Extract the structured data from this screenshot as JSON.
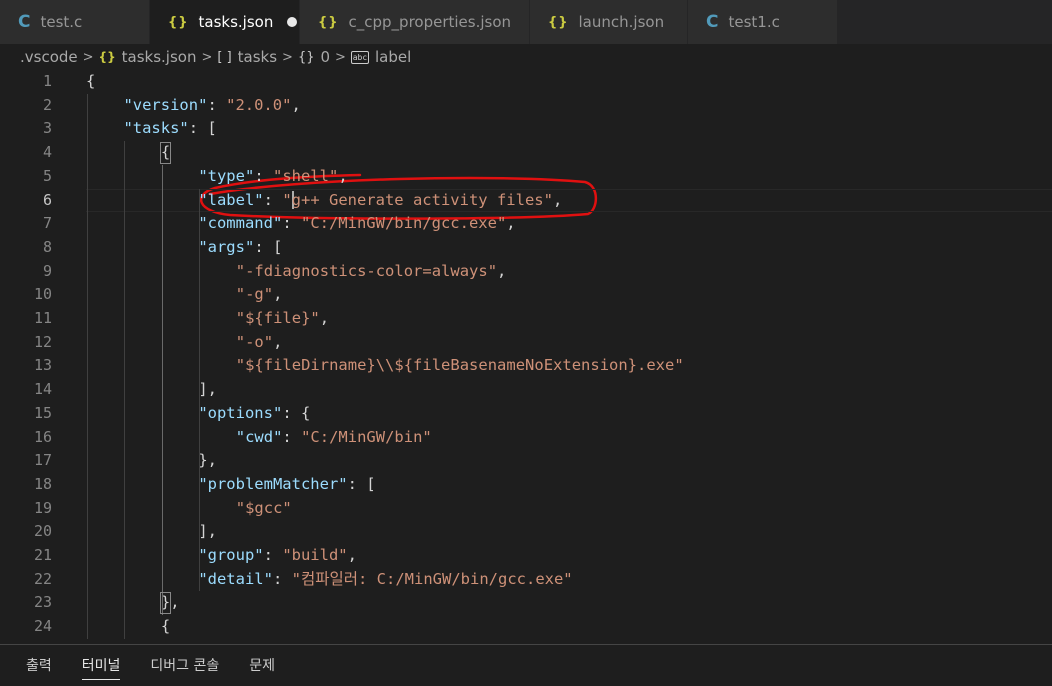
{
  "tabs": [
    {
      "label": "test.c",
      "icon": "C",
      "type": "c",
      "active": false,
      "width": 150
    },
    {
      "label": "tasks.json",
      "icon": "{}",
      "type": "json",
      "active": true,
      "modified": true,
      "width": 150
    },
    {
      "label": "c_cpp_properties.json",
      "icon": "{}",
      "type": "json",
      "active": false,
      "width": 230
    },
    {
      "label": "launch.json",
      "icon": "{}",
      "type": "json",
      "active": false,
      "width": 158
    },
    {
      "label": "test1.c",
      "icon": "C",
      "type": "c",
      "active": false,
      "width": 150
    }
  ],
  "breadcrumb": [
    {
      "label": ".vscode",
      "icon": ""
    },
    {
      "label": "tasks.json",
      "icon": "json"
    },
    {
      "label": "tasks",
      "icon": "array"
    },
    {
      "label": "0",
      "icon": "object"
    },
    {
      "label": "label",
      "icon": "string"
    }
  ],
  "editor": {
    "current_line": 6,
    "lines": [
      {
        "n": "1",
        "indent": 0,
        "tokens": [
          [
            "p",
            "{"
          ]
        ]
      },
      {
        "n": "2",
        "indent": 1,
        "tokens": [
          [
            "k",
            "\"version\""
          ],
          [
            "p",
            ": "
          ],
          [
            "s",
            "\"2.0.0\""
          ],
          [
            "p",
            ","
          ]
        ]
      },
      {
        "n": "3",
        "indent": 1,
        "tokens": [
          [
            "k",
            "\"tasks\""
          ],
          [
            "p",
            ": ["
          ]
        ]
      },
      {
        "n": "4",
        "indent": 2,
        "tokens": [
          [
            "p",
            "{"
          ]
        ]
      },
      {
        "n": "5",
        "indent": 3,
        "tokens": [
          [
            "k",
            "\"type\""
          ],
          [
            "p",
            ": "
          ],
          [
            "s",
            "\"shell\""
          ],
          [
            "p",
            ","
          ]
        ]
      },
      {
        "n": "6",
        "indent": 3,
        "tokens": [
          [
            "k",
            "\"label\""
          ],
          [
            "p",
            ": "
          ],
          [
            "s",
            "\""
          ],
          [
            "caret",
            ""
          ],
          [
            "s",
            "g++ Generate activity files\""
          ],
          [
            "p",
            ","
          ]
        ]
      },
      {
        "n": "7",
        "indent": 3,
        "tokens": [
          [
            "k",
            "\"command\""
          ],
          [
            "p",
            ": "
          ],
          [
            "s",
            "\"C:/MinGW/bin/gcc.exe\""
          ],
          [
            "p",
            ","
          ]
        ]
      },
      {
        "n": "8",
        "indent": 3,
        "tokens": [
          [
            "k",
            "\"args\""
          ],
          [
            "p",
            ": ["
          ]
        ]
      },
      {
        "n": "9",
        "indent": 4,
        "tokens": [
          [
            "s",
            "\"-fdiagnostics-color=always\""
          ],
          [
            "p",
            ","
          ]
        ]
      },
      {
        "n": "10",
        "indent": 4,
        "tokens": [
          [
            "s",
            "\"-g\""
          ],
          [
            "p",
            ","
          ]
        ]
      },
      {
        "n": "11",
        "indent": 4,
        "tokens": [
          [
            "s",
            "\"${file}\""
          ],
          [
            "p",
            ","
          ]
        ]
      },
      {
        "n": "12",
        "indent": 4,
        "tokens": [
          [
            "s",
            "\"-o\""
          ],
          [
            "p",
            ","
          ]
        ]
      },
      {
        "n": "13",
        "indent": 4,
        "tokens": [
          [
            "s",
            "\"${fileDirname}\\\\${fileBasenameNoExtension}.exe\""
          ]
        ]
      },
      {
        "n": "14",
        "indent": 3,
        "tokens": [
          [
            "p",
            "],"
          ]
        ]
      },
      {
        "n": "15",
        "indent": 3,
        "tokens": [
          [
            "k",
            "\"options\""
          ],
          [
            "p",
            ": {"
          ]
        ]
      },
      {
        "n": "16",
        "indent": 4,
        "tokens": [
          [
            "k",
            "\"cwd\""
          ],
          [
            "p",
            ": "
          ],
          [
            "s",
            "\"C:/MinGW/bin\""
          ]
        ]
      },
      {
        "n": "17",
        "indent": 3,
        "tokens": [
          [
            "p",
            "},"
          ]
        ]
      },
      {
        "n": "18",
        "indent": 3,
        "tokens": [
          [
            "k",
            "\"problemMatcher\""
          ],
          [
            "p",
            ": ["
          ]
        ]
      },
      {
        "n": "19",
        "indent": 4,
        "tokens": [
          [
            "s",
            "\"$gcc\""
          ]
        ]
      },
      {
        "n": "20",
        "indent": 3,
        "tokens": [
          [
            "p",
            "],"
          ]
        ]
      },
      {
        "n": "21",
        "indent": 3,
        "tokens": [
          [
            "k",
            "\"group\""
          ],
          [
            "p",
            ": "
          ],
          [
            "s",
            "\"build\""
          ],
          [
            "p",
            ","
          ]
        ]
      },
      {
        "n": "22",
        "indent": 3,
        "tokens": [
          [
            "k",
            "\"detail\""
          ],
          [
            "p",
            ": "
          ],
          [
            "s",
            "\"컴파일러: C:/MinGW/bin/gcc.exe\""
          ]
        ]
      },
      {
        "n": "23",
        "indent": 2,
        "tokens": [
          [
            "p",
            "},"
          ]
        ]
      },
      {
        "n": "24",
        "indent": 2,
        "tokens": [
          [
            "p",
            "{"
          ]
        ]
      }
    ]
  },
  "panel": {
    "tabs": [
      {
        "label": "출력",
        "active": false
      },
      {
        "label": "터미널",
        "active": true
      },
      {
        "label": "디버그 콘솔",
        "active": false
      },
      {
        "label": "문제",
        "active": false
      }
    ]
  },
  "colors": {
    "key": "#9cdcfe",
    "string": "#ce9178",
    "annotation": "#e01010"
  }
}
